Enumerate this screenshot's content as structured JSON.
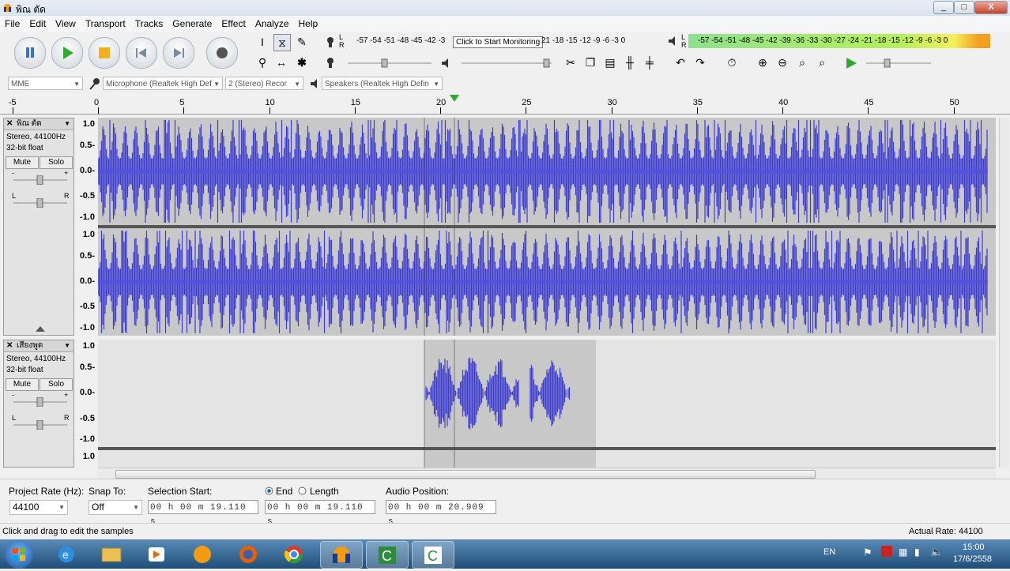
{
  "window": {
    "title": "พิณ ตัด",
    "min": "_",
    "max": "□",
    "close": "X"
  },
  "menu": [
    "File",
    "Edit",
    "View",
    "Transport",
    "Tracks",
    "Generate",
    "Effect",
    "Analyze",
    "Help"
  ],
  "meters": {
    "record_scale": "-57 -54 -51 -48 -45 -42 -3",
    "record_scale_tail": "21 -18 -15 -12 -9 -6 -3 0",
    "tooltip": "Click to Start Monitoring",
    "play_scale": "-57 -54 -51 -48 -45 -42 -39 -36 -33 -30 -27 -24 -21 -18 -15 -12 -9 -6 -3 0",
    "rec_L": "L",
    "rec_R": "R",
    "play_L": "L",
    "play_R": "R"
  },
  "device": {
    "host": "MME",
    "input": "Microphone (Realtek High Def",
    "channels": "2 (Stereo) Recor",
    "output": "Speakers (Realtek High Defin"
  },
  "ruler": {
    "ticks": [
      "-5",
      "0",
      "5",
      "10",
      "15",
      "20",
      "25",
      "30",
      "35",
      "40",
      "45",
      "50"
    ]
  },
  "tracks": [
    {
      "name": "พิณ ตัด",
      "info1": "Stereo, 44100Hz",
      "info2": "32-bit float",
      "mute": "Mute",
      "solo": "Solo",
      "scale": [
        "1.0",
        "0.5-",
        "0.0-",
        "-0.5",
        "-1.0"
      ],
      "scale2": [
        "1.0",
        "0.5-",
        "0.0-",
        "-0.5",
        "-1.0"
      ]
    },
    {
      "name": "เสียงพูด",
      "info1": "Stereo, 44100Hz",
      "info2": "32-bit float",
      "mute": "Mute",
      "solo": "Solo",
      "scale": [
        "1.0",
        "0.5-",
        "0.0-",
        "-0.5",
        "-1.0"
      ],
      "scale2": [
        "1.0"
      ]
    }
  ],
  "gain": {
    "minus": "-",
    "plus": "+",
    "left": "L",
    "right": "R"
  },
  "selection": {
    "project_rate_label": "Project Rate (Hz):",
    "project_rate": "44100",
    "snap_label": "Snap To:",
    "snap": "Off",
    "start_label": "Selection Start:",
    "start": "00 h 00 m 19.110 s",
    "end_label": "End",
    "length_label": "Length",
    "end": "00 h 00 m 19.110 s",
    "audio_pos_label": "Audio Position:",
    "audio_pos": "00 h 00 m 20.909 s"
  },
  "status": {
    "left": "Click and drag to edit the samples",
    "right": "Actual Rate: 44100"
  },
  "taskbar": {
    "lang": "EN",
    "time": "15:00",
    "date": "17/6/2558"
  }
}
